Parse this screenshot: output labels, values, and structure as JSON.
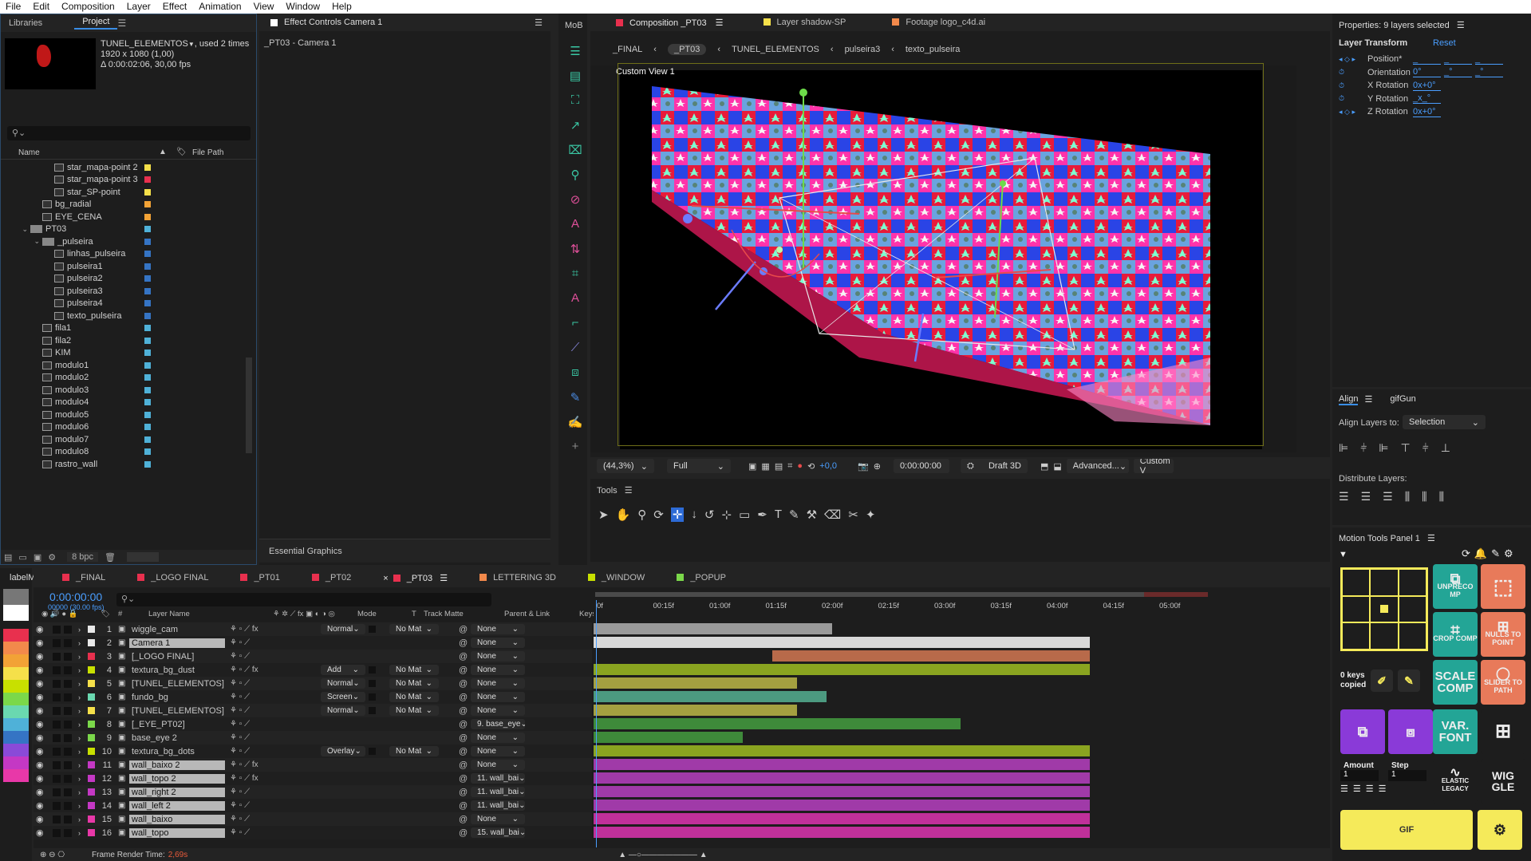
{
  "menu": [
    "File",
    "Edit",
    "Composition",
    "Layer",
    "Effect",
    "Animation",
    "View",
    "Window",
    "Help"
  ],
  "project": {
    "tabs": [
      "Libraries",
      "Project"
    ],
    "effects_tab": "Effect Controls Camera 1",
    "effects_sub": "_PT03 - Camera 1",
    "comp_name": "TUNEL_ELEMENTOS",
    "used": ", used 2 times",
    "dims": "1920 x 1080 (1,00)",
    "duration": "Δ 0:00:02:06, 30,00 fps",
    "search_placeholder": "",
    "col_name": "Name",
    "col_path": "File Path",
    "bpc": "8 bpc",
    "items": [
      {
        "name": "star_mapa-point 2",
        "indent": 3,
        "type": "comp",
        "color": "#f5e04a"
      },
      {
        "name": "star_mapa-point 3",
        "indent": 3,
        "type": "comp",
        "color": "#e8304e"
      },
      {
        "name": "star_SP-point",
        "indent": 3,
        "type": "comp",
        "color": "#f5e04a"
      },
      {
        "name": "bg_radial",
        "indent": 2,
        "type": "comp",
        "color": "#f2a236"
      },
      {
        "name": "EYE_CENA",
        "indent": 2,
        "type": "comp",
        "color": "#f2a236"
      },
      {
        "name": "PT03",
        "indent": 1,
        "type": "folder",
        "color": "#4fb1d8"
      },
      {
        "name": "_pulseira",
        "indent": 2,
        "type": "folder",
        "color": "#3574c4"
      },
      {
        "name": "linhas_pulseira",
        "indent": 3,
        "type": "comp",
        "color": "#3574c4"
      },
      {
        "name": "pulseira1",
        "indent": 3,
        "type": "comp",
        "color": "#3574c4"
      },
      {
        "name": "pulseira2",
        "indent": 3,
        "type": "comp",
        "color": "#3574c4"
      },
      {
        "name": "pulseira3",
        "indent": 3,
        "type": "comp",
        "color": "#3574c4"
      },
      {
        "name": "pulseira4",
        "indent": 3,
        "type": "comp",
        "color": "#3574c4"
      },
      {
        "name": "texto_pulseira",
        "indent": 3,
        "type": "comp",
        "color": "#3574c4"
      },
      {
        "name": "fila1",
        "indent": 2,
        "type": "comp",
        "color": "#4fb1d8"
      },
      {
        "name": "fila2",
        "indent": 2,
        "type": "comp",
        "color": "#4fb1d8"
      },
      {
        "name": "KIM",
        "indent": 2,
        "type": "comp",
        "color": "#4fb1d8"
      },
      {
        "name": "modulo1",
        "indent": 2,
        "type": "comp",
        "color": "#4fb1d8"
      },
      {
        "name": "modulo2",
        "indent": 2,
        "type": "comp",
        "color": "#4fb1d8"
      },
      {
        "name": "modulo3",
        "indent": 2,
        "type": "comp",
        "color": "#4fb1d8"
      },
      {
        "name": "modulo4",
        "indent": 2,
        "type": "comp",
        "color": "#4fb1d8"
      },
      {
        "name": "modulo5",
        "indent": 2,
        "type": "comp",
        "color": "#4fb1d8"
      },
      {
        "name": "modulo6",
        "indent": 2,
        "type": "comp",
        "color": "#4fb1d8"
      },
      {
        "name": "modulo7",
        "indent": 2,
        "type": "comp",
        "color": "#4fb1d8"
      },
      {
        "name": "modulo8",
        "indent": 2,
        "type": "comp",
        "color": "#4fb1d8"
      },
      {
        "name": "rastro_wall",
        "indent": 2,
        "type": "comp",
        "color": "#4fb1d8"
      }
    ],
    "essential": "Essential Graphics"
  },
  "viewer": {
    "mob_tab": "MoB",
    "tabs": [
      {
        "label": "Composition _PT03",
        "color": "#e8304e"
      },
      {
        "label": "Layer shadow-SP",
        "color": "#f5e04a"
      },
      {
        "label": "Footage logo_c4d.ai",
        "color": "#f2894b"
      }
    ],
    "breadcrumb": [
      "_FINAL",
      "_PT03",
      "TUNEL_ELEMENTOS",
      "pulseira3",
      "texto_pulseira"
    ],
    "view_label": "Custom View 1",
    "zoom": "(44,3%)",
    "resolution": "Full",
    "exposure": "+0,0",
    "timecode": "0:00:00:00",
    "renderer": "Draft 3D",
    "advanced": "Advanced...",
    "custom": "Custom V"
  },
  "tools": {
    "title": "Tools"
  },
  "properties": {
    "title": "Properties: 9 layers selected",
    "section": "Layer Transform",
    "reset": "Reset",
    "rows": [
      {
        "name": "Position*",
        "v1": "_",
        "v2": "_",
        "v3": "_"
      },
      {
        "name": "Orientation",
        "v1": "0°",
        "v2": "_°",
        "v3": "_°"
      },
      {
        "name": "X Rotation",
        "v1": "0x+0°"
      },
      {
        "name": "Y Rotation",
        "v1": "_x_°"
      },
      {
        "name": "Z Rotation",
        "v1": "0x+0°"
      }
    ]
  },
  "align": {
    "tabs": [
      "Align",
      "gifGun"
    ],
    "align_to_label": "Align Layers to:",
    "align_to_value": "Selection",
    "distribute_label": "Distribute Layers:"
  },
  "motion": {
    "title": "Motion Tools Panel 1",
    "unprecomp": "UNPRECO MP",
    "crop": "CROP COMP",
    "nulls": "NULLS TO POINT",
    "keys": "0 keys copied",
    "scale": "SCALE COMP",
    "slider": "SLIDER TO PATH",
    "var": "VAR. FONT",
    "amount_label": "Amount",
    "amount_value": "1",
    "step_label": "Step",
    "step_value": "1",
    "elastic": "ELASTIC LEGACY",
    "wiggle": "WIG GLE",
    "gif": "GIF"
  },
  "timeline": {
    "label_tab": "labelM",
    "tabs": [
      {
        "label": "_FINAL",
        "color": "#e8304e"
      },
      {
        "label": "_LOGO FINAL",
        "color": "#e8304e"
      },
      {
        "label": "_PT01",
        "color": "#e8304e"
      },
      {
        "label": "_PT02",
        "color": "#e8304e"
      },
      {
        "label": "_PT03",
        "color": "#e8304e"
      },
      {
        "label": "LETTERING 3D",
        "color": "#f2894b"
      },
      {
        "label": "_WINDOW",
        "color": "#c8e000"
      },
      {
        "label": "_POPUP",
        "color": "#7bd84a"
      }
    ],
    "timecode": "0:00:00:00",
    "fps": "00000 (30.00 fps)",
    "headers": {
      "num": "#",
      "name": "Layer Name",
      "mode": "Mode",
      "t": "T",
      "matte": "Track Matte",
      "parent": "Parent & Link",
      "keys": "Keys"
    },
    "ruler": [
      "0f",
      "00:15f",
      "01:00f",
      "01:15f",
      "02:00f",
      "02:15f",
      "03:00f",
      "03:15f",
      "04:00f",
      "04:15f",
      "05:00f"
    ],
    "render_label": "Frame Render Time:",
    "render_value": "2,69s",
    "layers": [
      {
        "n": "1",
        "name": "wiggle_cam",
        "label": "#e8e8e8",
        "mode": "Normal",
        "matte": "No Mat",
        "parent": "None",
        "bar": "#9a9a9a",
        "start": 0,
        "end": 0.48
      },
      {
        "n": "2",
        "name": "Camera 1",
        "label": "#e8e8e8",
        "mode": "",
        "matte": "",
        "parent": "None",
        "bar": "#d8d8d8",
        "start": 0,
        "end": 1
      },
      {
        "n": "3",
        "name": "[_LOGO FINAL]",
        "label": "#e8304e",
        "mode": "",
        "matte": "",
        "parent": "None",
        "bar": "#b86a4a",
        "start": 0.36,
        "end": 1
      },
      {
        "n": "4",
        "name": "textura_bg_dust",
        "label": "#c8e000",
        "mode": "Add",
        "matte": "No Mat",
        "parent": "None",
        "bar": "#8aa420",
        "start": 0,
        "end": 1
      },
      {
        "n": "5",
        "name": "[TUNEL_ELEMENTOS]",
        "label": "#f5e04a",
        "mode": "Normal",
        "matte": "No Mat",
        "parent": "None",
        "bar": "#a4a040",
        "start": 0,
        "end": 0.41
      },
      {
        "n": "6",
        "name": "fundo_bg",
        "label": "#6ad8b0",
        "mode": "Screen",
        "matte": "No Mat",
        "parent": "None",
        "bar": "#4c9a80",
        "start": 0,
        "end": 0.47
      },
      {
        "n": "7",
        "name": "[TUNEL_ELEMENTOS]",
        "label": "#f5e04a",
        "mode": "Normal",
        "matte": "No Mat",
        "parent": "None",
        "bar": "#a4a040",
        "start": 0,
        "end": 0.41
      },
      {
        "n": "8",
        "name": "[_EYE_PT02]",
        "label": "#7bd84a",
        "mode": "",
        "matte": "",
        "parent": "9. base_eye",
        "bar": "#3e8a3a",
        "start": 0,
        "end": 0.74
      },
      {
        "n": "9",
        "name": "base_eye 2",
        "label": "#7bd84a",
        "mode": "",
        "matte": "",
        "parent": "None",
        "bar": "#3e8a3a",
        "start": 0,
        "end": 0.3
      },
      {
        "n": "10",
        "name": "textura_bg_dots",
        "label": "#c8e000",
        "mode": "Overlay",
        "matte": "No Mat",
        "parent": "None",
        "bar": "#8aa420",
        "start": 0,
        "end": 1
      },
      {
        "n": "11",
        "name": "wall_baixo 2",
        "label": "#c438c4",
        "mode": "",
        "matte": "",
        "parent": "None",
        "bar": "#a03aa8",
        "start": 0,
        "end": 1
      },
      {
        "n": "12",
        "name": "wall_topo 2",
        "label": "#c438c4",
        "mode": "",
        "matte": "",
        "parent": "11. wall_bai",
        "bar": "#a03aa8",
        "start": 0,
        "end": 1
      },
      {
        "n": "13",
        "name": "wall_right 2",
        "label": "#c438c4",
        "mode": "",
        "matte": "",
        "parent": "11. wall_bai",
        "bar": "#a03aa8",
        "start": 0,
        "end": 1
      },
      {
        "n": "14",
        "name": "wall_left 2",
        "label": "#c438c4",
        "mode": "",
        "matte": "",
        "parent": "11. wall_bai",
        "bar": "#a03aa8",
        "start": 0,
        "end": 1
      },
      {
        "n": "15",
        "name": "wall_baixo",
        "label": "#e838a8",
        "mode": "",
        "matte": "",
        "parent": "None",
        "bar": "#c0309a",
        "start": 0,
        "end": 1
      },
      {
        "n": "16",
        "name": "wall_topo",
        "label": "#e838a8",
        "mode": "",
        "matte": "",
        "parent": "15. wall_bai",
        "bar": "#c0309a",
        "start": 0,
        "end": 1
      }
    ]
  },
  "label_colors": [
    "#777777",
    "#ffffff",
    "#e8304e",
    "#f2894b",
    "#f2a236",
    "#f5e04a",
    "#c8e000",
    "#7bd84a",
    "#6ad8b0",
    "#4fb1d8",
    "#3574c4",
    "#8a4ad8",
    "#c438c4",
    "#e838a8"
  ]
}
